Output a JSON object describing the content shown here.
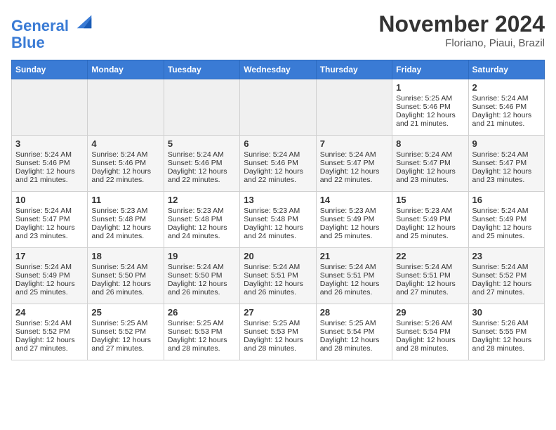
{
  "header": {
    "logo_line1": "General",
    "logo_line2": "Blue",
    "month": "November 2024",
    "location": "Floriano, Piaui, Brazil"
  },
  "days_of_week": [
    "Sunday",
    "Monday",
    "Tuesday",
    "Wednesday",
    "Thursday",
    "Friday",
    "Saturday"
  ],
  "weeks": [
    [
      {
        "day": "",
        "info": ""
      },
      {
        "day": "",
        "info": ""
      },
      {
        "day": "",
        "info": ""
      },
      {
        "day": "",
        "info": ""
      },
      {
        "day": "",
        "info": ""
      },
      {
        "day": "1",
        "info": "Sunrise: 5:25 AM\nSunset: 5:46 PM\nDaylight: 12 hours\nand 21 minutes."
      },
      {
        "day": "2",
        "info": "Sunrise: 5:24 AM\nSunset: 5:46 PM\nDaylight: 12 hours\nand 21 minutes."
      }
    ],
    [
      {
        "day": "3",
        "info": "Sunrise: 5:24 AM\nSunset: 5:46 PM\nDaylight: 12 hours\nand 21 minutes."
      },
      {
        "day": "4",
        "info": "Sunrise: 5:24 AM\nSunset: 5:46 PM\nDaylight: 12 hours\nand 22 minutes."
      },
      {
        "day": "5",
        "info": "Sunrise: 5:24 AM\nSunset: 5:46 PM\nDaylight: 12 hours\nand 22 minutes."
      },
      {
        "day": "6",
        "info": "Sunrise: 5:24 AM\nSunset: 5:46 PM\nDaylight: 12 hours\nand 22 minutes."
      },
      {
        "day": "7",
        "info": "Sunrise: 5:24 AM\nSunset: 5:47 PM\nDaylight: 12 hours\nand 22 minutes."
      },
      {
        "day": "8",
        "info": "Sunrise: 5:24 AM\nSunset: 5:47 PM\nDaylight: 12 hours\nand 23 minutes."
      },
      {
        "day": "9",
        "info": "Sunrise: 5:24 AM\nSunset: 5:47 PM\nDaylight: 12 hours\nand 23 minutes."
      }
    ],
    [
      {
        "day": "10",
        "info": "Sunrise: 5:24 AM\nSunset: 5:47 PM\nDaylight: 12 hours\nand 23 minutes."
      },
      {
        "day": "11",
        "info": "Sunrise: 5:23 AM\nSunset: 5:48 PM\nDaylight: 12 hours\nand 24 minutes."
      },
      {
        "day": "12",
        "info": "Sunrise: 5:23 AM\nSunset: 5:48 PM\nDaylight: 12 hours\nand 24 minutes."
      },
      {
        "day": "13",
        "info": "Sunrise: 5:23 AM\nSunset: 5:48 PM\nDaylight: 12 hours\nand 24 minutes."
      },
      {
        "day": "14",
        "info": "Sunrise: 5:23 AM\nSunset: 5:49 PM\nDaylight: 12 hours\nand 25 minutes."
      },
      {
        "day": "15",
        "info": "Sunrise: 5:23 AM\nSunset: 5:49 PM\nDaylight: 12 hours\nand 25 minutes."
      },
      {
        "day": "16",
        "info": "Sunrise: 5:24 AM\nSunset: 5:49 PM\nDaylight: 12 hours\nand 25 minutes."
      }
    ],
    [
      {
        "day": "17",
        "info": "Sunrise: 5:24 AM\nSunset: 5:49 PM\nDaylight: 12 hours\nand 25 minutes."
      },
      {
        "day": "18",
        "info": "Sunrise: 5:24 AM\nSunset: 5:50 PM\nDaylight: 12 hours\nand 26 minutes."
      },
      {
        "day": "19",
        "info": "Sunrise: 5:24 AM\nSunset: 5:50 PM\nDaylight: 12 hours\nand 26 minutes."
      },
      {
        "day": "20",
        "info": "Sunrise: 5:24 AM\nSunset: 5:51 PM\nDaylight: 12 hours\nand 26 minutes."
      },
      {
        "day": "21",
        "info": "Sunrise: 5:24 AM\nSunset: 5:51 PM\nDaylight: 12 hours\nand 26 minutes."
      },
      {
        "day": "22",
        "info": "Sunrise: 5:24 AM\nSunset: 5:51 PM\nDaylight: 12 hours\nand 27 minutes."
      },
      {
        "day": "23",
        "info": "Sunrise: 5:24 AM\nSunset: 5:52 PM\nDaylight: 12 hours\nand 27 minutes."
      }
    ],
    [
      {
        "day": "24",
        "info": "Sunrise: 5:24 AM\nSunset: 5:52 PM\nDaylight: 12 hours\nand 27 minutes."
      },
      {
        "day": "25",
        "info": "Sunrise: 5:25 AM\nSunset: 5:52 PM\nDaylight: 12 hours\nand 27 minutes."
      },
      {
        "day": "26",
        "info": "Sunrise: 5:25 AM\nSunset: 5:53 PM\nDaylight: 12 hours\nand 28 minutes."
      },
      {
        "day": "27",
        "info": "Sunrise: 5:25 AM\nSunset: 5:53 PM\nDaylight: 12 hours\nand 28 minutes."
      },
      {
        "day": "28",
        "info": "Sunrise: 5:25 AM\nSunset: 5:54 PM\nDaylight: 12 hours\nand 28 minutes."
      },
      {
        "day": "29",
        "info": "Sunrise: 5:26 AM\nSunset: 5:54 PM\nDaylight: 12 hours\nand 28 minutes."
      },
      {
        "day": "30",
        "info": "Sunrise: 5:26 AM\nSunset: 5:55 PM\nDaylight: 12 hours\nand 28 minutes."
      }
    ]
  ]
}
